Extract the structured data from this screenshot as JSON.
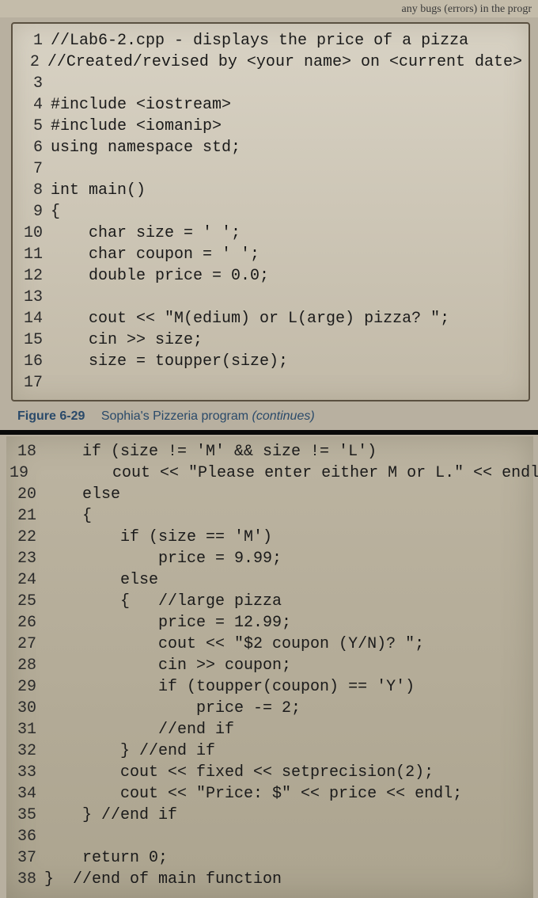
{
  "header_text": "any bugs (errors) in the progr",
  "caption": {
    "figure": "Figure 6-29",
    "title": "Sophia's Pizzeria program ",
    "continues": "(continues)"
  },
  "block1": [
    {
      "n": "1",
      "t": "//Lab6-2.cpp - displays the price of a pizza"
    },
    {
      "n": "2",
      "t": "//Created/revised by <your name> on <current date>"
    },
    {
      "n": "3",
      "t": ""
    },
    {
      "n": "4",
      "t": "#include <iostream>"
    },
    {
      "n": "5",
      "t": "#include <iomanip>"
    },
    {
      "n": "6",
      "t": "using namespace std;"
    },
    {
      "n": "7",
      "t": ""
    },
    {
      "n": "8",
      "t": "int main()"
    },
    {
      "n": "9",
      "t": "{"
    },
    {
      "n": "10",
      "t": "    char size = ' ';"
    },
    {
      "n": "11",
      "t": "    char coupon = ' ';"
    },
    {
      "n": "12",
      "t": "    double price = 0.0;"
    },
    {
      "n": "13",
      "t": ""
    },
    {
      "n": "14",
      "t": "    cout << \"M(edium) or L(arge) pizza? \";"
    },
    {
      "n": "15",
      "t": "    cin >> size;"
    },
    {
      "n": "16",
      "t": "    size = toupper(size);"
    },
    {
      "n": "17",
      "t": ""
    }
  ],
  "block2": [
    {
      "n": "18",
      "t": "    if (size != 'M' && size != 'L')"
    },
    {
      "n": "19",
      "t": "        cout << \"Please enter either M or L.\" << endl;"
    },
    {
      "n": "20",
      "t": "    else"
    },
    {
      "n": "21",
      "t": "    {"
    },
    {
      "n": "22",
      "t": "        if (size == 'M')"
    },
    {
      "n": "23",
      "t": "            price = 9.99;"
    },
    {
      "n": "24",
      "t": "        else"
    },
    {
      "n": "25",
      "t": "        {   //large pizza"
    },
    {
      "n": "26",
      "t": "            price = 12.99;"
    },
    {
      "n": "27",
      "t": "            cout << \"$2 coupon (Y/N)? \";"
    },
    {
      "n": "28",
      "t": "            cin >> coupon;"
    },
    {
      "n": "29",
      "t": "            if (toupper(coupon) == 'Y')"
    },
    {
      "n": "30",
      "t": "                price -= 2;"
    },
    {
      "n": "31",
      "t": "            //end if"
    },
    {
      "n": "32",
      "t": "        } //end if"
    },
    {
      "n": "33",
      "t": "        cout << fixed << setprecision(2);"
    },
    {
      "n": "34",
      "t": "        cout << \"Price: $\" << price << endl;"
    },
    {
      "n": "35",
      "t": "    } //end if"
    },
    {
      "n": "36",
      "t": ""
    },
    {
      "n": "37",
      "t": "    return 0;"
    },
    {
      "n": "38",
      "t": "}  //end of main function"
    }
  ]
}
